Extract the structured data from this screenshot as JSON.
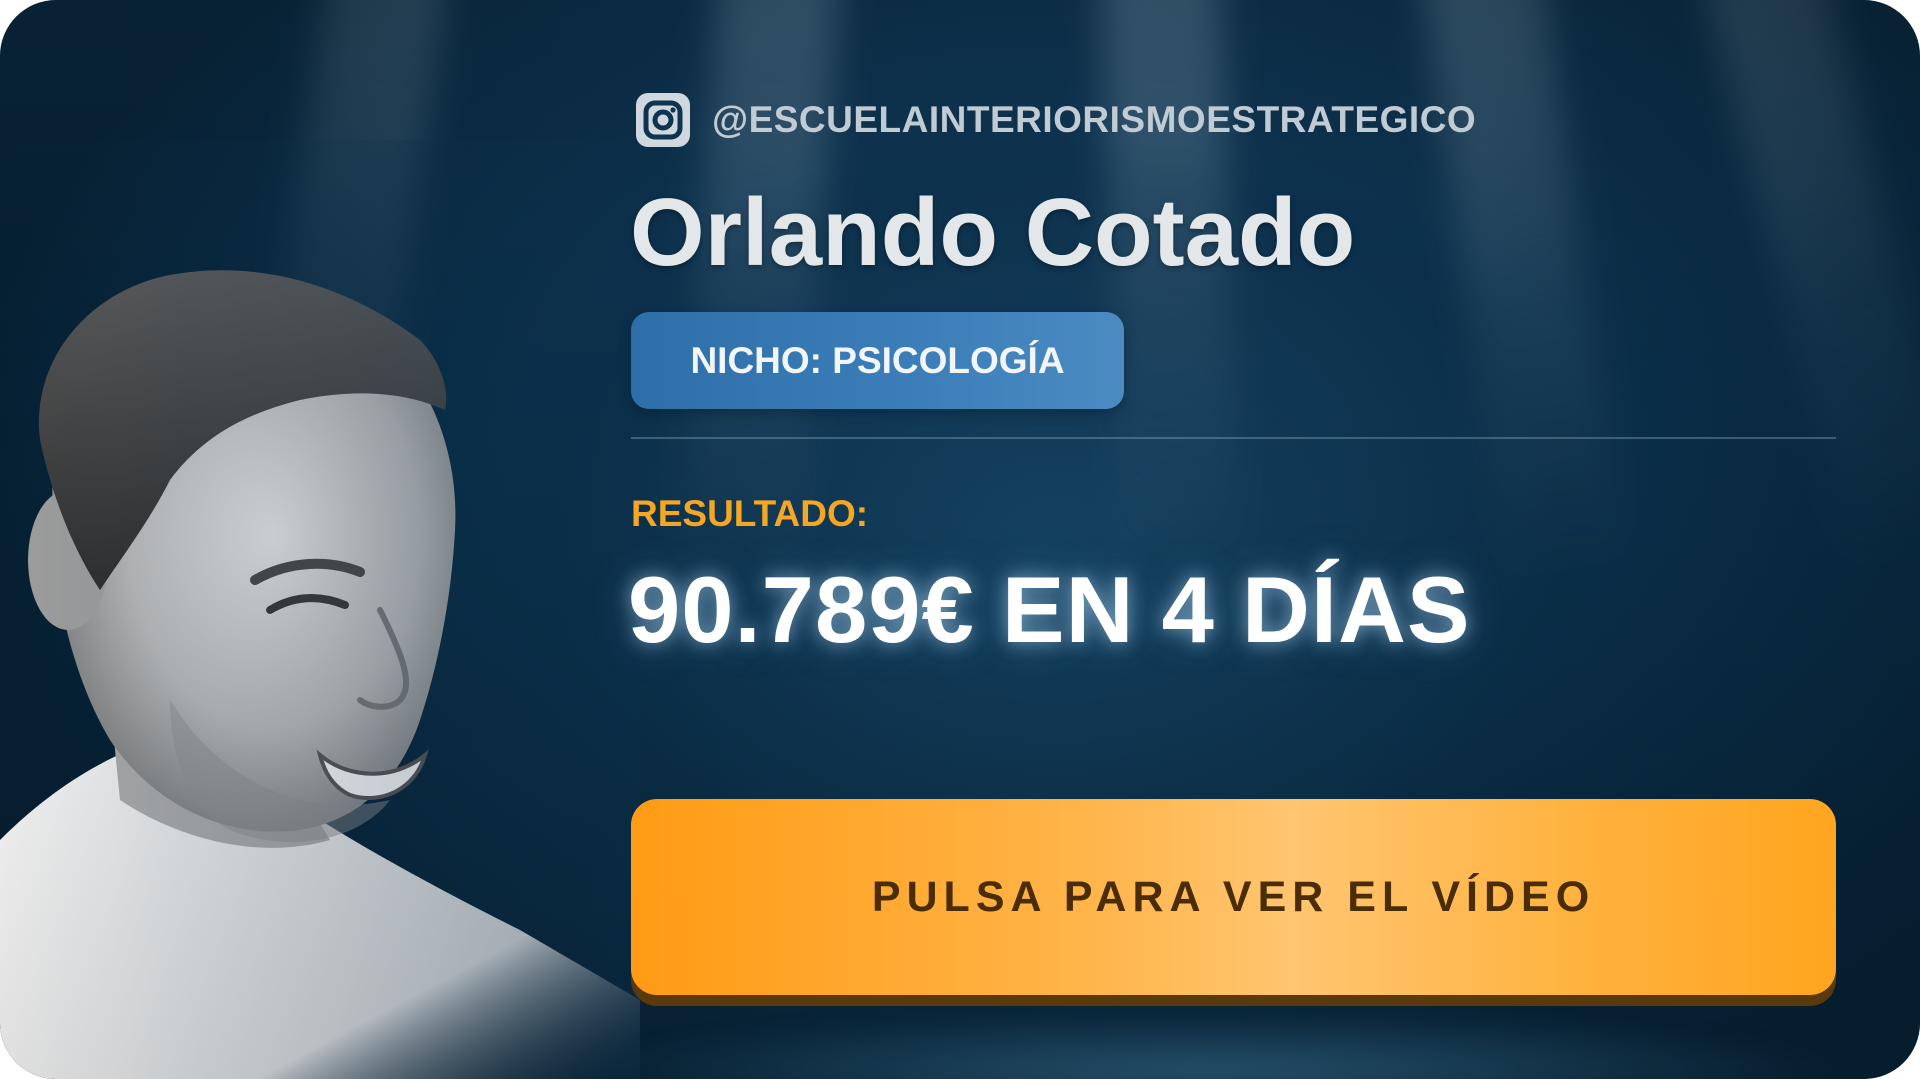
{
  "profile": {
    "instagram_icon": "instagram-icon",
    "handle": "@ESCUELAINTERIORISMOESTRATEGICO",
    "name": "Orlando Cotado",
    "niche_label": "NICHO: PSICOLOGÍA"
  },
  "result": {
    "label": "RESULTADO:",
    "value": "90.789€ EN 4 DÍAS"
  },
  "cta": {
    "label": "PULSA PARA VER EL VÍDEO"
  },
  "colors": {
    "background": "#0b2f4a",
    "accent_orange": "#f5a623",
    "cta_gradient_start": "#ff9b14",
    "cta_gradient_mid": "#ffc570",
    "niche_badge": "#3a7db8",
    "text_light": "#e3e7ea"
  }
}
